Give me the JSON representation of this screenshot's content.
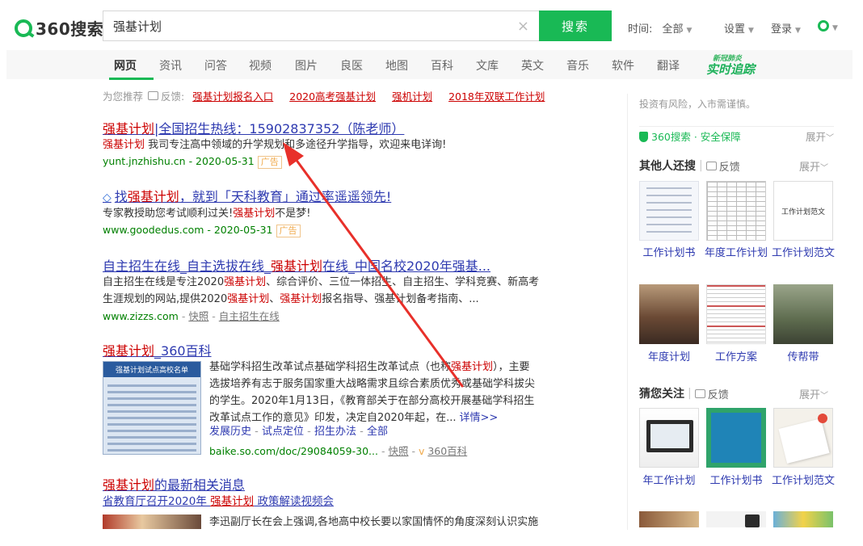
{
  "header": {
    "logo_text": "360搜索",
    "search_value": "强基计划",
    "clear_glyph": "×",
    "search_button": "搜索",
    "time_label": "时间:",
    "time_value": "全部",
    "settings": "设置",
    "login": "登录"
  },
  "nav": {
    "items": [
      "网页",
      "资讯",
      "问答",
      "视频",
      "图片",
      "良医",
      "地图",
      "百科",
      "文库",
      "英文",
      "音乐",
      "软件",
      "翻译"
    ],
    "active": "网页",
    "promo_top": "新冠肺炎",
    "promo_main": "实时追踪"
  },
  "recommend": {
    "label": "为您推荐",
    "feedback": "反馈:",
    "links": [
      "强基计划报名入口",
      "2020高考强基计划",
      "强机计划",
      "2018年双联工作计划"
    ]
  },
  "results": [
    {
      "title_hl": "强基计划",
      "title_rest": "|全国招生热线：15902837352（陈老师）",
      "desc_hl": "强基计划",
      "desc_rest": " 我司专注高中领域的升学规划和多途径升学指导，欢迎来电详询!",
      "url": "yunt.jnzhishu.cn - 2020-05-31",
      "badge": "广告"
    },
    {
      "title_pre": "找",
      "title_hl": "强基计划",
      "title_rest": "，就到「天科教育」通过率遥遥领先!",
      "desc_pre": "专家教授助您考试顺利过关!",
      "desc_hl": "强基计划",
      "desc_rest": "不是梦!",
      "url": "www.goodedus.com - 2020-05-31",
      "badge": "广告"
    },
    {
      "title_pre": "自主招生在线_自主选拔在线_",
      "title_hl": "强基计划",
      "title_rest": "在线_中国名校2020年强基...",
      "line1_pre": "自主招生在线是专注2020",
      "line1_hl": "强基计划",
      "line1_rest": "、综合评价、三位一体招生、自主招生、学科竞赛、新高考",
      "line2_pre": "生涯规划的网站,提供2020",
      "line2_hl": "强基计划",
      "line2_mid": "、",
      "line2_hl2": "强基计划",
      "line2_rest": "报名指导、强基计划备考指南、...",
      "url": "www.zizzs.com",
      "snapshot": "快照",
      "sep": " - ",
      "extra_link": "自主招生在线"
    },
    {
      "title_hl": "强基计划",
      "title_rest": "_360百科",
      "img_title": "强基计划试点高校名单",
      "line1_pre": "基础学科招生改革试点基础学科招生改革试点（也称",
      "line1_hl": "强基计划",
      "line1_rest": "），主要",
      "line2": "选拔培养有志于服务国家重大战略需求且综合素质优秀或基础学科拔尖",
      "line3": "的学生。2020年1月13日，《教育部关于在部分高校开展基础学科招生",
      "line4": "改革试点工作的意见》印发，决定自2020年起，在...",
      "more": "详情>>",
      "links": [
        "发展历史",
        "试点定位",
        "招生办法",
        "全部"
      ],
      "url": "baike.so.com/doc/29084059-30...",
      "snapshot": "快照",
      "source": "360百科"
    },
    {
      "title_hl": "强基计划",
      "title_rest": "的最新相关消息",
      "sub_pre": "省教育厅召开2020年 ",
      "sub_hl": "强基计划",
      "sub_rest": " 政策解读视频会",
      "desc": "李迅副厅长在会上强调,各地高中校长要以家国情怀的角度深刻认识实施"
    }
  ],
  "sidebar": {
    "risk_notice": "投资有风险，入市需谨慎。",
    "safety": "360搜索 · 安全保障",
    "expand": "展开",
    "section1_title": "其他人还搜",
    "section1_feedback": "反馈",
    "section1_items": [
      "工作计划书",
      "年度工作计划",
      "工作计划范文",
      "年度计划",
      "工作方案",
      "传帮带"
    ],
    "thumb_text": "工作计划范文",
    "section2_title": "猜您关注",
    "section2_feedback": "反馈",
    "section2_items": [
      "年工作计划",
      "工作计划书",
      "工作计划范文"
    ]
  },
  "colors": {
    "brand": "#19b955",
    "link": "#2e3ab0",
    "highlight": "#cc0000",
    "url": "#008000",
    "arrow": "#e8302a"
  }
}
